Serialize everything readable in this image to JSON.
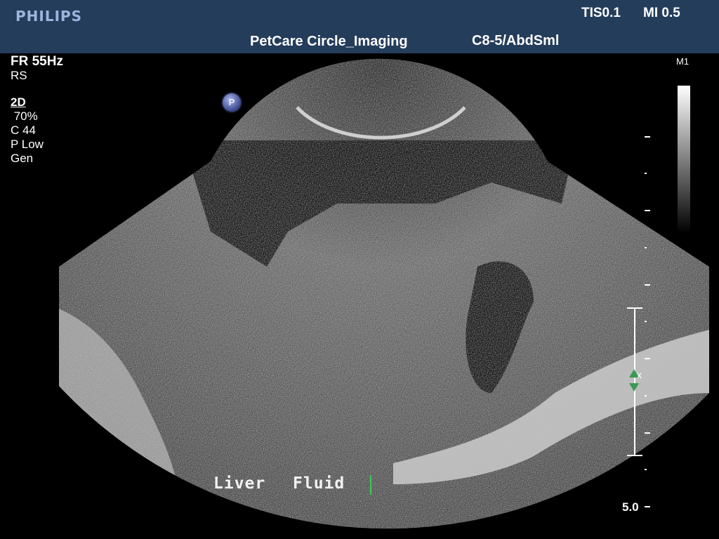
{
  "header": {
    "brand": "PHILIPS",
    "tis": "TIS0.1",
    "mi": "MI 0.5",
    "clinic": "PetCare Circle_Imaging",
    "probe_preset": "C8-5/AbdSml"
  },
  "params": {
    "frame_rate": "FR 55Hz",
    "resolution": "RS",
    "mode": "2D",
    "gain": " 70%",
    "compression": "C 44",
    "persistence": "P Low",
    "frequency": "Gen"
  },
  "icons": {
    "p_badge": "P"
  },
  "grayscale_map": "M1",
  "depth_label": "5.0",
  "annotations": {
    "left": "Liver",
    "right": "Fluid"
  }
}
